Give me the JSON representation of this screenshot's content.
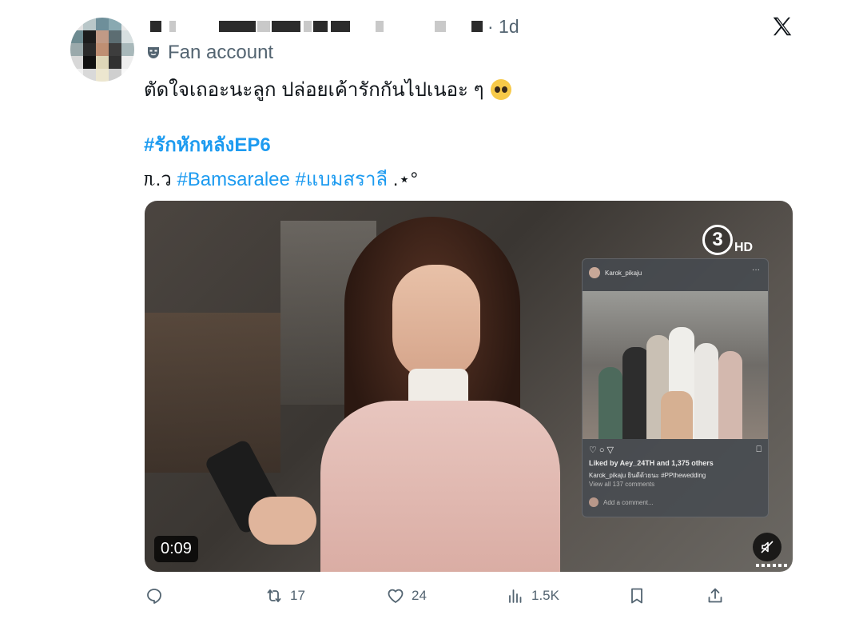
{
  "post": {
    "timestamp": "· 1d",
    "badge_label": "Fan account",
    "text_line1": "ตัดใจเถอะนะลูก ปล่อยเค้ารักกันไปเนอะ ๆ",
    "hashtag_main": "#รักหักหลังEP6",
    "line3_prefix": "ᥰ.ว",
    "hashtag_1": "#Bamsaralee",
    "hashtag_2": "#แบมสราลี",
    "line3_suffix": ".⋆°"
  },
  "video": {
    "duration": "0:09",
    "channel_number": "3",
    "channel_quality": "HD",
    "ig_card": {
      "username": "Karok_pikaju",
      "liked_by": "Liked by Aey_24TH and 1,375 others",
      "caption": "Karok_pikaju ยินดีด้วยนะ #PPthewedding",
      "view_comments": "View all 137 comments",
      "add_comment": "Add a comment..."
    }
  },
  "actions": {
    "reply_count": "",
    "repost_count": "17",
    "like_count": "24",
    "views_count": "1.5K"
  },
  "colors": {
    "accent": "#1d9bf0",
    "muted_text": "#536471"
  },
  "icons": [
    "x-logo-icon",
    "mask-icon",
    "reply-icon",
    "repost-icon",
    "like-icon",
    "views-icon",
    "bookmark-icon",
    "share-icon",
    "mute-icon"
  ]
}
